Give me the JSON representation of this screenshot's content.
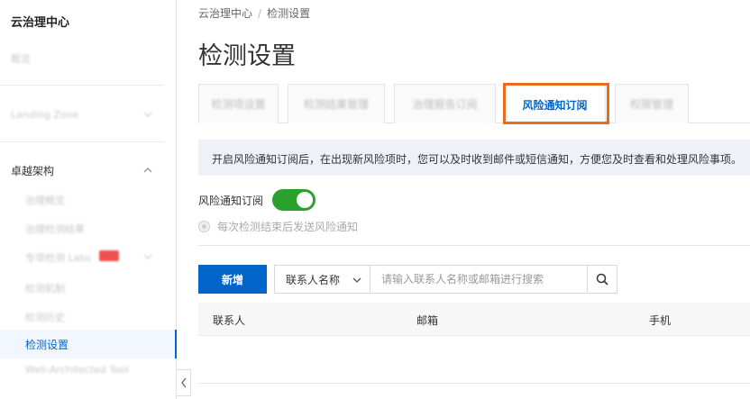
{
  "sidebar": {
    "title": "云治理中心",
    "items": [
      {
        "label": "概览"
      },
      {
        "label": "Landing Zone"
      }
    ],
    "group": {
      "label": "卓越架构"
    },
    "sub_items": [
      {
        "label": "治理概览"
      },
      {
        "label": "治理检测结果"
      },
      {
        "label": "专项检测 Labs"
      },
      {
        "label": "检测机制"
      },
      {
        "label": "检测历史"
      },
      {
        "label": "检测设置"
      },
      {
        "label": "Well-Architected Tool"
      }
    ],
    "active_item": "检测设置"
  },
  "breadcrumb": [
    "云治理中心",
    "检测设置"
  ],
  "page_title": "检测设置",
  "tabs": [
    {
      "label": "检测项设置",
      "active": false
    },
    {
      "label": "检测结果管理",
      "active": false
    },
    {
      "label": "治理报告订阅",
      "active": false
    },
    {
      "label": "风险通知订阅",
      "active": true
    },
    {
      "label": "权限管理",
      "active": false
    }
  ],
  "notice": "开启风险通知订阅后，在出现新风险项时，您可以及时收到邮件或短信通知，方便您及时查看和处理风险事项。",
  "subscription": {
    "label": "风险通知订阅",
    "enabled": true,
    "radio_label": "每次检测结束后发送风险通知"
  },
  "toolbar": {
    "add_label": "新增",
    "select_value": "联系人名称",
    "search_placeholder": "请输入联系人名称或邮箱进行搜索"
  },
  "table": {
    "columns": [
      "联系人",
      "邮箱",
      "手机"
    ]
  },
  "colors": {
    "primary": "#0064c8",
    "toggle_on": "#2aa12d",
    "highlight": "#e86b1f",
    "badge": "#f05050"
  }
}
